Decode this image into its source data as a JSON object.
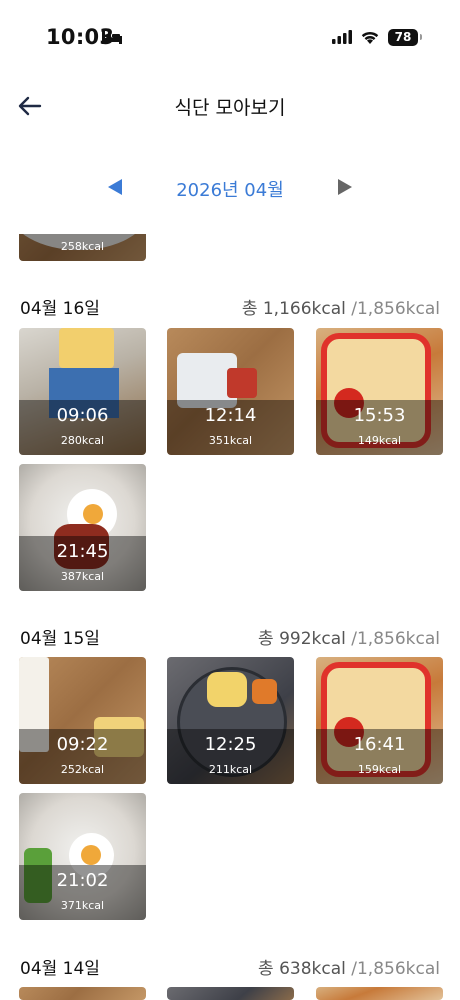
{
  "status": {
    "time": "10:03",
    "battery": "78"
  },
  "header": {
    "title": "식단 모아보기"
  },
  "month_nav": {
    "label": "2026년 04월"
  },
  "partial_top": {
    "kcal": "258kcal"
  },
  "days": [
    {
      "date": "04월 16일",
      "total": "총 1,166kcal",
      "target": "/1,856kcal",
      "meals": [
        {
          "time": "09:06",
          "kcal": "280kcal"
        },
        {
          "time": "12:14",
          "kcal": "351kcal"
        },
        {
          "time": "15:53",
          "kcal": "149kcal"
        },
        {
          "time": "21:45",
          "kcal": "387kcal"
        }
      ]
    },
    {
      "date": "04월 15일",
      "total": "총 992kcal",
      "target": "/1,856kcal",
      "meals": [
        {
          "time": "09:22",
          "kcal": "252kcal"
        },
        {
          "time": "12:25",
          "kcal": "211kcal"
        },
        {
          "time": "16:41",
          "kcal": "159kcal"
        },
        {
          "time": "21:02",
          "kcal": "371kcal"
        }
      ]
    },
    {
      "date": "04월 14일",
      "total": "총 638kcal",
      "target": "/1,856kcal",
      "meals": []
    }
  ],
  "colors": {
    "accent": "#3b7bd6",
    "nav_arrow_prev": "#3b7bd6",
    "nav_arrow_next": "#666666"
  },
  "icons": {
    "back": "arrow-left-icon",
    "prev": "triangle-left-icon",
    "next": "triangle-right-icon",
    "bed": "bed-icon",
    "signal": "cellular-signal-icon",
    "wifi": "wifi-icon",
    "battery": "battery-icon"
  }
}
